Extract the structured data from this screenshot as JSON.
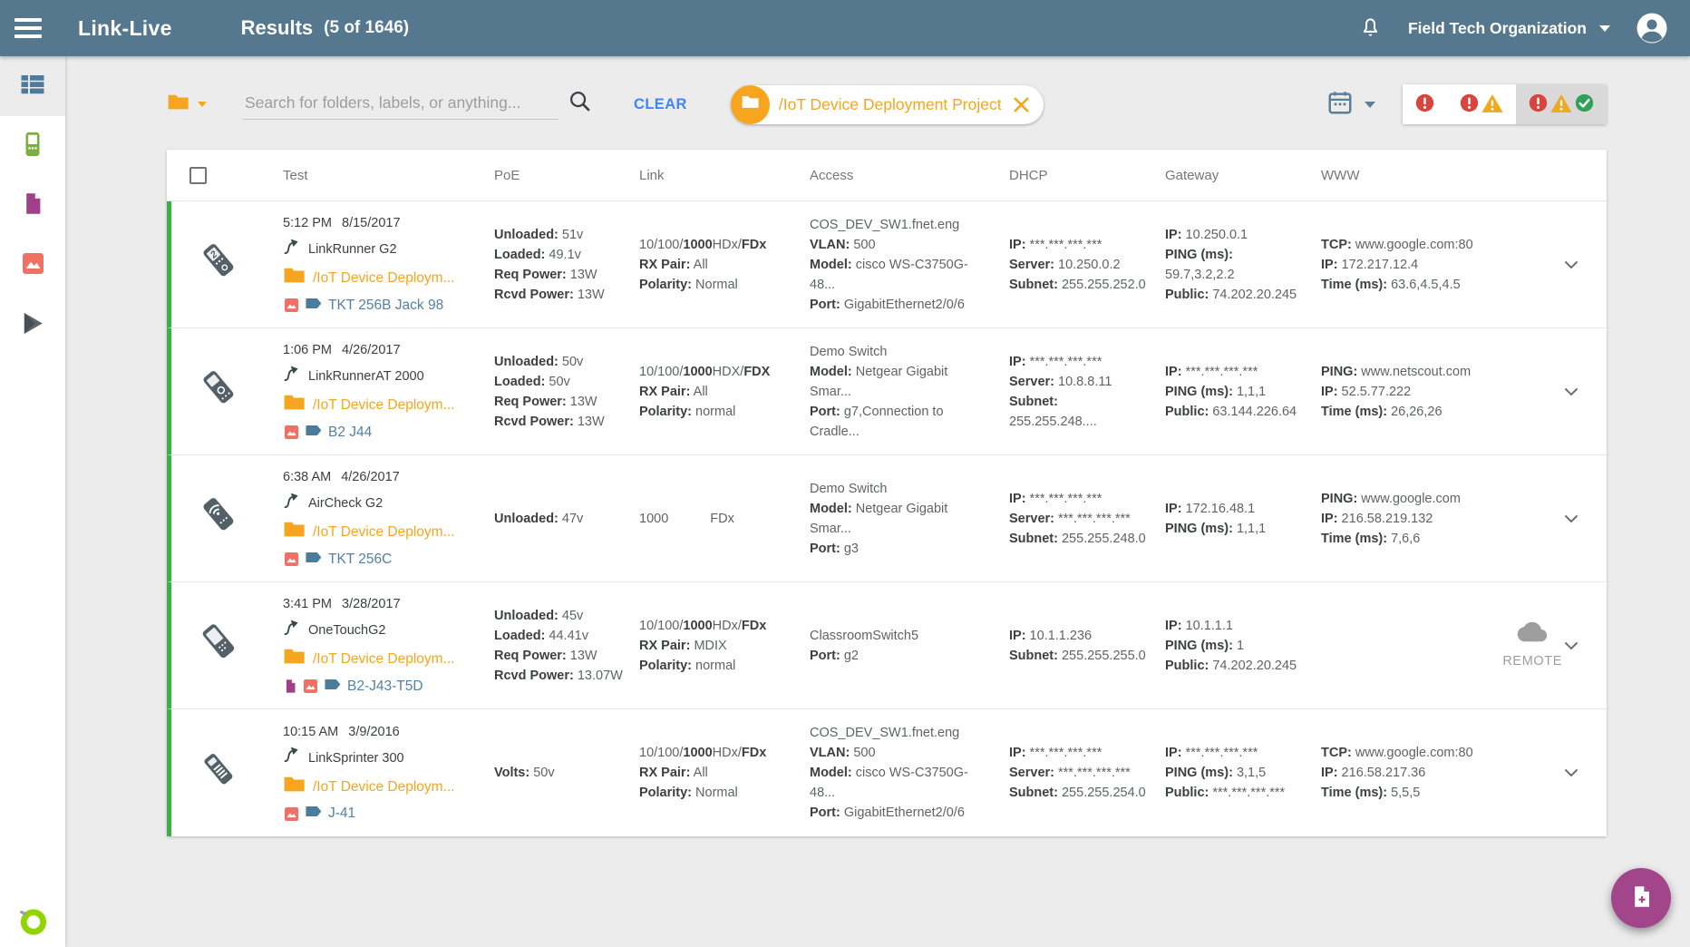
{
  "header": {
    "brand": "Link-Live",
    "title": "Results",
    "count": "(5 of 1646)",
    "org": "Field Tech Organization"
  },
  "sidebar": {
    "items": [
      {
        "id": "results",
        "icon": "table-list-icon",
        "selected": true
      },
      {
        "id": "units",
        "icon": "handheld-device-icon",
        "selected": false
      },
      {
        "id": "reports",
        "icon": "document-icon",
        "selected": false
      },
      {
        "id": "photos",
        "icon": "image-icon",
        "selected": false
      },
      {
        "id": "app-store",
        "icon": "play-icon",
        "selected": false
      }
    ],
    "logo_icon": "netally-ring-logo"
  },
  "filterbar": {
    "search_placeholder": "Search for folders, labels, or anything...",
    "clear_label": "CLEAR",
    "chip_label": "/IoT Device Deployment Project"
  },
  "status_filters": [
    {
      "id": "errors",
      "icons": [
        "error-icon"
      ],
      "selected": false
    },
    {
      "id": "errors-warnings",
      "icons": [
        "error-icon",
        "warning-icon"
      ],
      "selected": false
    },
    {
      "id": "errors-warnings-success",
      "icons": [
        "error-icon",
        "warning-icon",
        "success-icon"
      ],
      "selected": true
    }
  ],
  "remote_label": "REMOTE",
  "colors": {
    "header_bg": "#56788E",
    "accent_orange": "#F5A61E",
    "link_blue": "#4285F4",
    "label_blue": "#5380A4",
    "row_green": "#3FAE49",
    "error_red": "#D8453E",
    "warn_yellow": "#F0A81C",
    "ok_green": "#30A257",
    "fab_purple": "#A3458B",
    "logo_green": "#92D400"
  },
  "table": {
    "columns": [
      "Test",
      "PoE",
      "Link",
      "Access",
      "DHCP",
      "Gateway",
      "WWW"
    ],
    "rows": [
      {
        "device_icon": "linkrunner-g2-device-icon",
        "time": "5:12 PM",
        "date": "8/15/2017",
        "device": "LinkRunner G2",
        "folder": "/IoT Device Deploym...",
        "label": "TKT 256B Jack 98",
        "label_icons": [
          "image-icon"
        ],
        "poe": [
          [
            {
              "t": "Unloaded:",
              "b": 1
            },
            {
              "t": " 51v"
            }
          ],
          [
            {
              "t": "Loaded:",
              "b": 1
            },
            {
              "t": " 49.1v"
            }
          ],
          [
            {
              "t": "Req Power:",
              "b": 1
            },
            {
              "t": " 13W"
            }
          ],
          [
            {
              "t": "Rcvd Power:",
              "b": 1
            },
            {
              "t": " 13W"
            }
          ]
        ],
        "link": [
          [
            {
              "t": "10/100/"
            },
            {
              "t": "1000",
              "b": 1
            },
            {
              "t": "HDx/"
            },
            {
              "t": "FDx",
              "b": 1
            }
          ],
          [
            {
              "t": "RX Pair:",
              "b": 1
            },
            {
              "t": " All"
            }
          ],
          [
            {
              "t": "Polarity:",
              "b": 1
            },
            {
              "t": " Normal"
            }
          ]
        ],
        "access": [
          [
            {
              "t": "COS_DEV_SW1.fnet.eng"
            }
          ],
          [
            {
              "t": "VLAN:",
              "b": 1
            },
            {
              "t": " 500"
            }
          ],
          [
            {
              "t": "Model:",
              "b": 1
            },
            {
              "t": " cisco WS-C3750G-48..."
            }
          ],
          [
            {
              "t": "Port:",
              "b": 1
            },
            {
              "t": " GigabitEthernet2/0/6"
            }
          ]
        ],
        "dhcp": [
          [
            {
              "t": "IP:",
              "b": 1
            },
            {
              "t": " ***.***.***.***"
            }
          ],
          [
            {
              "t": "Server:",
              "b": 1
            },
            {
              "t": " 10.250.0.2"
            }
          ],
          [
            {
              "t": "Subnet:",
              "b": 1
            },
            {
              "t": " 255.255.252.0"
            }
          ]
        ],
        "gateway": [
          [
            {
              "t": "IP:",
              "b": 1
            },
            {
              "t": " 10.250.0.1"
            }
          ],
          [
            {
              "t": "PING (ms):",
              "b": 1
            },
            {
              "t": " 59.7,3.2,2.2"
            }
          ],
          [
            {
              "t": "Public:",
              "b": 1
            },
            {
              "t": " 74.202.20.245"
            }
          ]
        ],
        "www": [
          [
            {
              "t": "TCP:",
              "b": 1
            },
            {
              "t": " www.google.com:80"
            }
          ],
          [
            {
              "t": "IP:",
              "b": 1
            },
            {
              "t": " 172.217.12.4"
            }
          ],
          [
            {
              "t": "Time (ms):",
              "b": 1
            },
            {
              "t": " 63.6,4.5,4.5"
            }
          ]
        ],
        "www_remote": false
      },
      {
        "device_icon": "linkrunner-at-device-icon",
        "time": "1:06 PM",
        "date": "4/26/2017",
        "device": "LinkRunnerAT 2000",
        "folder": "/IoT Device Deploym...",
        "label": "B2 J44",
        "label_icons": [
          "image-icon"
        ],
        "poe": [
          [
            {
              "t": "Unloaded:",
              "b": 1
            },
            {
              "t": " 50v"
            }
          ],
          [
            {
              "t": "Loaded:",
              "b": 1
            },
            {
              "t": " 50v"
            }
          ],
          [
            {
              "t": "Req Power:",
              "b": 1
            },
            {
              "t": " 13W"
            }
          ],
          [
            {
              "t": "Rcvd Power:",
              "b": 1
            },
            {
              "t": " 13W"
            }
          ]
        ],
        "link": [
          [
            {
              "t": "10/100/"
            },
            {
              "t": "1000",
              "b": 1
            },
            {
              "t": "HDX/"
            },
            {
              "t": "FDX",
              "b": 1
            }
          ],
          [
            {
              "t": "RX Pair:",
              "b": 1
            },
            {
              "t": " All"
            }
          ],
          [
            {
              "t": "Polarity:",
              "b": 1
            },
            {
              "t": " normal"
            }
          ]
        ],
        "access": [
          [
            {
              "t": "Demo Switch"
            }
          ],
          [
            {
              "t": "Model:",
              "b": 1
            },
            {
              "t": " Netgear Gigabit Smar..."
            }
          ],
          [
            {
              "t": "Port:",
              "b": 1
            },
            {
              "t": " g7,Connection to Cradle..."
            }
          ]
        ],
        "dhcp": [
          [
            {
              "t": "IP:",
              "b": 1
            },
            {
              "t": " ***.***.***.***"
            }
          ],
          [
            {
              "t": "Server:",
              "b": 1
            },
            {
              "t": " 10.8.8.11"
            }
          ],
          [
            {
              "t": "Subnet:",
              "b": 1
            },
            {
              "t": " 255.255.248...."
            }
          ]
        ],
        "gateway": [
          [
            {
              "t": "IP:",
              "b": 1
            },
            {
              "t": " ***.***.***.***"
            }
          ],
          [
            {
              "t": "PING (ms):",
              "b": 1
            },
            {
              "t": " 1,1,1"
            }
          ],
          [
            {
              "t": "Public:",
              "b": 1
            },
            {
              "t": " 63.144.226.64"
            }
          ]
        ],
        "www": [
          [
            {
              "t": "PING:",
              "b": 1
            },
            {
              "t": " www.netscout.com"
            }
          ],
          [
            {
              "t": "IP:",
              "b": 1
            },
            {
              "t": " 52.5.77.222"
            }
          ],
          [
            {
              "t": "Time (ms):",
              "b": 1
            },
            {
              "t": " 26,26,26"
            }
          ]
        ],
        "www_remote": false
      },
      {
        "device_icon": "aircheck-g2-device-icon",
        "time": "6:38 AM",
        "date": "4/26/2017",
        "device": "AirCheck G2",
        "folder": "/IoT Device Deploym...",
        "label": "TKT 256C",
        "label_icons": [
          "image-icon"
        ],
        "poe": [
          [
            {
              "t": "Unloaded:",
              "b": 1
            },
            {
              "t": " 47v"
            }
          ]
        ],
        "link": [
          [
            {
              "t": "1000"
            },
            {
              "t": "FDx",
              "gap": 1
            }
          ]
        ],
        "access": [
          [
            {
              "t": "Demo Switch"
            }
          ],
          [
            {
              "t": "Model:",
              "b": 1
            },
            {
              "t": " Netgear Gigabit Smar..."
            }
          ],
          [
            {
              "t": "Port:",
              "b": 1
            },
            {
              "t": " g3"
            }
          ]
        ],
        "dhcp": [
          [
            {
              "t": "IP:",
              "b": 1
            },
            {
              "t": " ***.***.***.***"
            }
          ],
          [
            {
              "t": "Server:",
              "b": 1
            },
            {
              "t": " ***.***.***.***"
            }
          ],
          [
            {
              "t": "Subnet:",
              "b": 1
            },
            {
              "t": " 255.255.248.0"
            }
          ]
        ],
        "gateway": [
          [
            {
              "t": "IP:",
              "b": 1
            },
            {
              "t": " 172.16.48.1"
            }
          ],
          [
            {
              "t": "PING (ms):",
              "b": 1
            },
            {
              "t": " 1,1,1"
            }
          ]
        ],
        "www": [
          [
            {
              "t": "PING:",
              "b": 1
            },
            {
              "t": " www.google.com"
            }
          ],
          [
            {
              "t": "IP:",
              "b": 1
            },
            {
              "t": " 216.58.219.132"
            }
          ],
          [
            {
              "t": "Time (ms):",
              "b": 1
            },
            {
              "t": " 7,6,6"
            }
          ]
        ],
        "www_remote": false
      },
      {
        "device_icon": "onetouch-g2-device-icon",
        "time": "3:41 PM",
        "date": "3/28/2017",
        "device": "OneTouchG2",
        "folder": "/IoT Device Deploym...",
        "label": "B2-J43-T5D",
        "label_icons": [
          "document-icon",
          "image-icon"
        ],
        "poe": [
          [
            {
              "t": "Unloaded:",
              "b": 1
            },
            {
              "t": " 45v"
            }
          ],
          [
            {
              "t": "Loaded:",
              "b": 1
            },
            {
              "t": " 44.41v"
            }
          ],
          [
            {
              "t": "Req Power:",
              "b": 1
            },
            {
              "t": " 13W"
            }
          ],
          [
            {
              "t": "Rcvd Power:",
              "b": 1
            },
            {
              "t": " 13.07W"
            }
          ]
        ],
        "link": [
          [
            {
              "t": "10/100/"
            },
            {
              "t": "1000",
              "b": 1
            },
            {
              "t": "HDx/"
            },
            {
              "t": "FDx",
              "b": 1
            }
          ],
          [
            {
              "t": "RX Pair:",
              "b": 1
            },
            {
              "t": " MDIX"
            }
          ],
          [
            {
              "t": "Polarity:",
              "b": 1
            },
            {
              "t": " normal"
            }
          ]
        ],
        "access": [
          [
            {
              "t": "ClassroomSwitch5"
            }
          ],
          [
            {
              "t": "Port:",
              "b": 1
            },
            {
              "t": " g2"
            }
          ]
        ],
        "dhcp": [
          [
            {
              "t": "IP:",
              "b": 1
            },
            {
              "t": " 10.1.1.236"
            }
          ],
          [
            {
              "t": "Subnet:",
              "b": 1
            },
            {
              "t": " 255.255.255.0"
            }
          ]
        ],
        "gateway": [
          [
            {
              "t": "IP:",
              "b": 1
            },
            {
              "t": " 10.1.1.1"
            }
          ],
          [
            {
              "t": "PING (ms):",
              "b": 1
            },
            {
              "t": " 1"
            }
          ],
          [
            {
              "t": "Public:",
              "b": 1
            },
            {
              "t": " 74.202.20.245"
            }
          ]
        ],
        "www": [],
        "www_remote": true
      },
      {
        "device_icon": "linksprinter-device-icon",
        "time": "10:15 AM",
        "date": "3/9/2016",
        "device": "LinkSprinter 300",
        "folder": "/IoT Device Deploym...",
        "label": "J-41",
        "label_icons": [
          "image-icon"
        ],
        "poe": [
          [
            {
              "t": "Volts:",
              "b": 1
            },
            {
              "t": " 50v"
            }
          ]
        ],
        "link": [
          [
            {
              "t": "10/100/"
            },
            {
              "t": "1000",
              "b": 1
            },
            {
              "t": "HDx/"
            },
            {
              "t": "FDx",
              "b": 1
            }
          ],
          [
            {
              "t": "RX Pair:",
              "b": 1
            },
            {
              "t": " All"
            }
          ],
          [
            {
              "t": "Polarity:",
              "b": 1
            },
            {
              "t": " Normal"
            }
          ]
        ],
        "access": [
          [
            {
              "t": "COS_DEV_SW1.fnet.eng"
            }
          ],
          [
            {
              "t": "VLAN:",
              "b": 1
            },
            {
              "t": " 500"
            }
          ],
          [
            {
              "t": "Model:",
              "b": 1
            },
            {
              "t": " cisco WS-C3750G-48..."
            }
          ],
          [
            {
              "t": "Port:",
              "b": 1
            },
            {
              "t": " GigabitEthernet2/0/6"
            }
          ]
        ],
        "dhcp": [
          [
            {
              "t": "IP:",
              "b": 1
            },
            {
              "t": " ***.***.***.***"
            }
          ],
          [
            {
              "t": "Server:",
              "b": 1
            },
            {
              "t": " ***.***.***.***"
            }
          ],
          [
            {
              "t": "Subnet:",
              "b": 1
            },
            {
              "t": " 255.255.254.0"
            }
          ]
        ],
        "gateway": [
          [
            {
              "t": "IP:",
              "b": 1
            },
            {
              "t": " ***.***.***.***"
            }
          ],
          [
            {
              "t": "PING (ms):",
              "b": 1
            },
            {
              "t": " 3,1,5"
            }
          ],
          [
            {
              "t": "Public:",
              "b": 1
            },
            {
              "t": " ***.***.***.***"
            }
          ]
        ],
        "www": [
          [
            {
              "t": "TCP:",
              "b": 1
            },
            {
              "t": " www.google.com:80"
            }
          ],
          [
            {
              "t": "IP:",
              "b": 1
            },
            {
              "t": " 216.58.217.36"
            }
          ],
          [
            {
              "t": "Time (ms):",
              "b": 1
            },
            {
              "t": " 5,5,5"
            }
          ]
        ],
        "www_remote": false
      }
    ]
  }
}
